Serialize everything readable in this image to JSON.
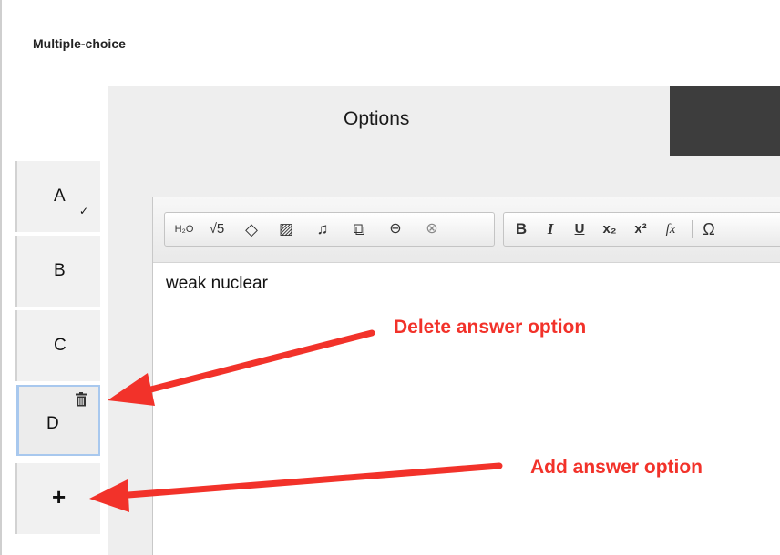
{
  "question_type": "Multiple-choice",
  "answer_options": [
    {
      "letter": "A",
      "correct_mark": "✓"
    },
    {
      "letter": "B"
    },
    {
      "letter": "C"
    },
    {
      "letter": "D"
    }
  ],
  "add_option_symbol": "+",
  "tabs": {
    "options_label": "Options"
  },
  "toolbar": {
    "chemistry": "H₂O",
    "math": "√5",
    "shape": "◇",
    "image": "▨",
    "audio": "♫",
    "video": "⧉",
    "link": "⊖",
    "unlink": "⊗",
    "bold": "B",
    "italic": "I",
    "underline": "U",
    "subscript": "x₂",
    "superscript": "x²",
    "formula": "fx",
    "omega": "Ω"
  },
  "editor": {
    "content": "weak nuclear"
  },
  "annotations": {
    "delete": "Delete answer option",
    "add": "Add answer option",
    "color": "#f2322a"
  },
  "colors": {
    "selected_border": "#a8c8ee",
    "dark_tab": "#3d3d3d",
    "panel_bg": "#eeeeee"
  }
}
